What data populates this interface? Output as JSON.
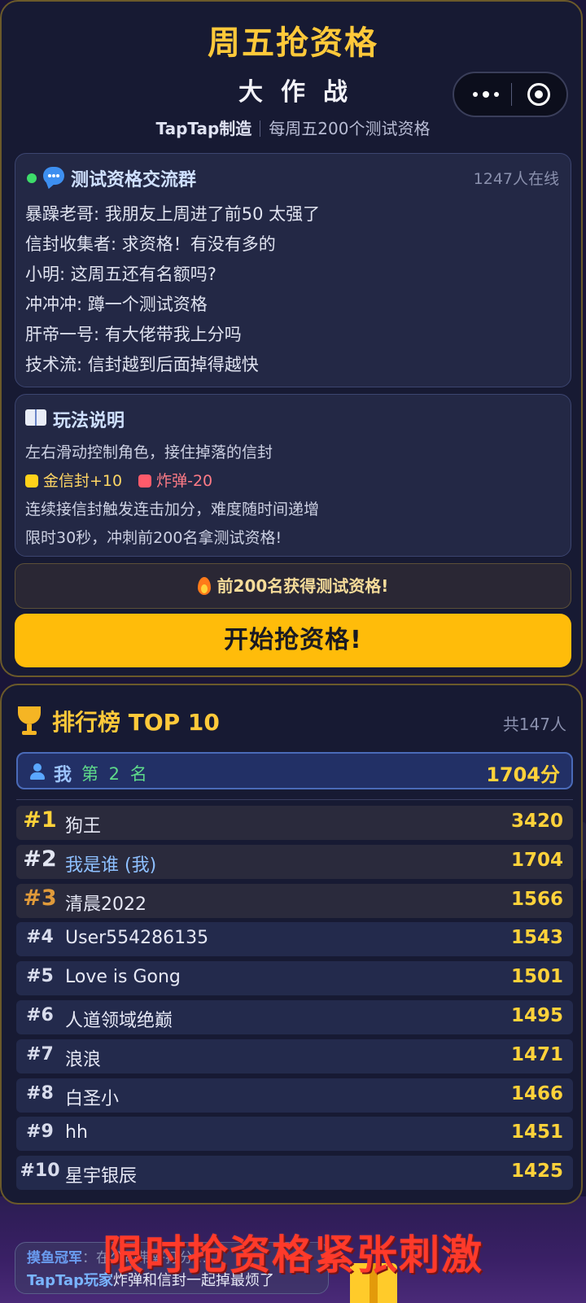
{
  "header": {
    "title": "周五抢资格",
    "subtitle": "大作战",
    "brand": "TapTap制造",
    "tagline": "每周五200个测试资格"
  },
  "chat": {
    "title": "测试资格交流群",
    "online": "1247人在线",
    "messages": [
      "暴躁老哥: 我朋友上周进了前50 太强了",
      "信封收集者: 求资格！有没有多的",
      "小明: 这周五还有名额吗?",
      "冲冲冲: 蹲一个测试资格",
      "肝帝一号: 有大佬带我上分吗",
      "技术流: 信封越到后面掉得越快"
    ]
  },
  "howto": {
    "title": "玩法说明",
    "line1": "左右滑动控制角色，接住掉落的信封",
    "gold_label": "金信封+10",
    "bomb_label": "炸弹-20",
    "line3": "连续接信封触发连击加分，难度随时间递增",
    "line4": "限时30秒，冲刺前200名拿测试资格!"
  },
  "banner": "前200名获得测试资格!",
  "start_button": "开始抢资格!",
  "leaderboard": {
    "title": "排行榜 TOP 10",
    "total": "共147人",
    "me": {
      "label": "我",
      "rank": "第 2 名",
      "score": "1704分"
    },
    "rows": [
      {
        "rank": "#1",
        "name": "狗王",
        "score": "3420"
      },
      {
        "rank": "#2",
        "name": "我是谁 (我)",
        "score": "1704"
      },
      {
        "rank": "#3",
        "name": "清晨2022",
        "score": "1566"
      },
      {
        "rank": "#4",
        "name": "User554286135",
        "score": "1543"
      },
      {
        "rank": "#5",
        "name": "Love is Gong",
        "score": "1501"
      },
      {
        "rank": "#6",
        "name": "人道领域绝巅",
        "score": "1495"
      },
      {
        "rank": "#7",
        "name": "浪浪",
        "score": "1471"
      },
      {
        "rank": "#8",
        "name": "白圣小",
        "score": "1466"
      },
      {
        "rank": "#9",
        "name": "hh",
        "score": "1451"
      },
      {
        "rank": "#10",
        "name": "星宇银辰",
        "score": "1425"
      }
    ]
  },
  "ticker": {
    "line1_user": "摸鱼冠军",
    "line1_text": "：在公司带薪打分…",
    "line2_user": "TapTap玩家",
    "line2_text": "炸弹和信封一起掉最烦了"
  },
  "promo": "限时抢资格紧张刺激",
  "colors": {
    "accent": "#ffc93a",
    "button": "#ffbc0a",
    "panel": "#171a33",
    "promo": "#ff3a2a"
  }
}
